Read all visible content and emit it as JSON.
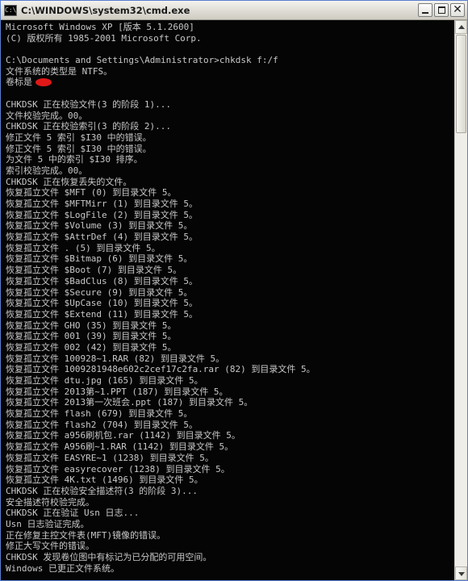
{
  "window": {
    "icon_label": "C:\\",
    "title": "C:\\WINDOWS\\system32\\cmd.exe"
  },
  "console": {
    "lines": [
      "Microsoft Windows XP [版本 5.1.2600]",
      "(C) 版权所有 1985-2001 Microsoft Corp.",
      "",
      "C:\\Documents and Settings\\Administrator>chkdsk f:/f",
      "文件系统的类型是 NTFS。",
      "卷标是",
      "",
      "CHKDSK 正在校验文件(3 的阶段 1)...",
      "文件校验完成。00。",
      "CHKDSK 正在校验索引(3 的阶段 2)...",
      "修正文件 5 索引 $I30 中的错误。",
      "修正文件 5 索引 $I30 中的错误。",
      "为文件 5 中的索引 $I30 排序。",
      "索引校验完成。00。",
      "CHKDSK 正在恢复丢失的文件。",
      "恢复孤立文件 $MFT (0) 到目录文件 5。",
      "恢复孤立文件 $MFTMirr (1) 到目录文件 5。",
      "恢复孤立文件 $LogFile (2) 到目录文件 5。",
      "恢复孤立文件 $Volume (3) 到目录文件 5。",
      "恢复孤立文件 $AttrDef (4) 到目录文件 5。",
      "恢复孤立文件 . (5) 到目录文件 5。",
      "恢复孤立文件 $Bitmap (6) 到目录文件 5。",
      "恢复孤立文件 $Boot (7) 到目录文件 5。",
      "恢复孤立文件 $BadClus (8) 到目录文件 5。",
      "恢复孤立文件 $Secure (9) 到目录文件 5。",
      "恢复孤立文件 $UpCase (10) 到目录文件 5。",
      "恢复孤立文件 $Extend (11) 到目录文件 5。",
      "恢复孤立文件 GHO (35) 到目录文件 5。",
      "恢复孤立文件 001 (39) 到目录文件 5。",
      "恢复孤立文件 002 (42) 到目录文件 5。",
      "恢复孤立文件 100928~1.RAR (82) 到目录文件 5。",
      "恢复孤立文件 1009281948e602c2cef17c2fa.rar (82) 到目录文件 5。",
      "恢复孤立文件 dtu.jpg (165) 到目录文件 5。",
      "恢复孤立文件 2013第~1.PPT (187) 到目录文件 5。",
      "恢复孤立文件 2013第一次班会.ppt (187) 到目录文件 5。",
      "恢复孤立文件 flash (679) 到目录文件 5。",
      "恢复孤立文件 flash2 (704) 到目录文件 5。",
      "恢复孤立文件 a956刷机包.rar (1142) 到目录文件 5。",
      "恢复孤立文件 A956刷~1.RAR (1142) 到目录文件 5。",
      "恢复孤立文件 EASYRE~1 (1238) 到目录文件 5。",
      "恢复孤立文件 easyrecover (1238) 到目录文件 5。",
      "恢复孤立文件 4K.txt (1496) 到目录文件 5。",
      "CHKDSK 正在校验安全描述符(3 的阶段 3)...",
      "安全描述符校验完成。",
      "CHKDSK 正在验证 Usn 日志...",
      "Usn 日志验证完成。",
      "正在修复主控文件表(MFT)镜像的错误。",
      "修正大写文件的错误。",
      "CHKDSK 发现卷位图中有标记为已分配的可用空间。",
      "Windows 已更正文件系统。"
    ]
  }
}
